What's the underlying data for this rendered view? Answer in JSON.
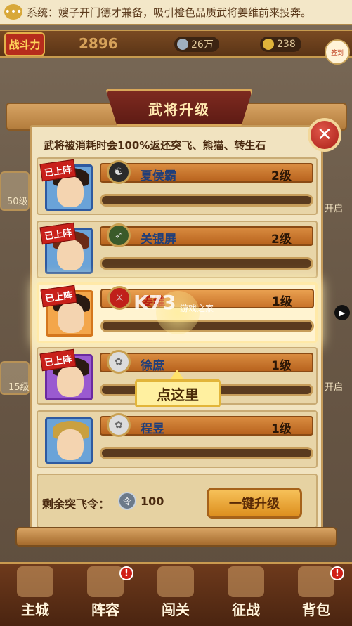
{
  "marquee": {
    "icon": "speech-bubble-icon",
    "text": "系统：嫂子开门德才兼备，吸引橙色品质武将姜维前来投奔。"
  },
  "power": {
    "label": "战斗力",
    "value": "2896",
    "coins": "26万",
    "ingots": "238"
  },
  "signin": {
    "label": "签到"
  },
  "side": {
    "left_level_1": "50级",
    "right_label_1": "开启",
    "left_level_2": "15级",
    "right_label_2": "开启"
  },
  "dialog": {
    "title": "武将升级",
    "notice": "武将被消耗时会100%返还突飞、熊猫、转生石",
    "deployed_label": "已上阵",
    "generals": [
      {
        "name": "夏侯霸",
        "level": "2级",
        "deployed": true,
        "rarity": "blue",
        "exp": 0.0
      },
      {
        "name": "关银屏",
        "level": "2级",
        "deployed": true,
        "rarity": "blue",
        "exp": 0.0
      },
      {
        "name": "姜维",
        "level": "1级",
        "deployed": true,
        "rarity": "orange",
        "exp": 0.0
      },
      {
        "name": "徐庶",
        "level": "1级",
        "deployed": true,
        "rarity": "purple",
        "exp": 0.0
      },
      {
        "name": "程昱",
        "level": "1级",
        "deployed": false,
        "rarity": "blue",
        "exp": 0.0
      }
    ],
    "tooltip": "点这里",
    "remain_label": "剩余突飞令：",
    "remain_value": "100",
    "onekey_label": "一键升级"
  },
  "watermark": {
    "main": "K73",
    "sub": "游戏之家"
  },
  "nav": [
    {
      "label": "主城",
      "badge": ""
    },
    {
      "label": "阵容",
      "badge": "!"
    },
    {
      "label": "闯关",
      "badge": ""
    },
    {
      "label": "征战",
      "badge": ""
    },
    {
      "label": "背包",
      "badge": "!"
    }
  ],
  "colors": {
    "accent": "#c8201a",
    "panel": "#f1e3c0",
    "name_bar": "#d98c40"
  }
}
